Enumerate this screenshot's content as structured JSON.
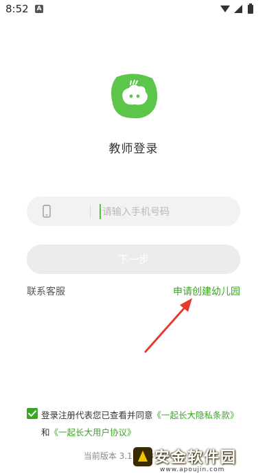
{
  "status_bar": {
    "time": "8:52",
    "notification_letter": "A"
  },
  "login": {
    "title": "教师登录",
    "phone_placeholder": "请输入手机号码",
    "next_label": "下一步",
    "contact_label": "联系客服",
    "apply_label": "申请创建幼儿园"
  },
  "agreement": {
    "checked": true,
    "prefix": "登录注册代表您已查看并同意",
    "privacy_link": "《一起长大隐私条款》",
    "and": "和",
    "user_link": "《一起长大用户协议》"
  },
  "footer": {
    "version": "当前版本 3.18.0(318000)"
  },
  "watermark": {
    "text": "安金软件园",
    "url": "www.apoujin.com"
  },
  "colors": {
    "brand_green": "#3aa624",
    "logo_green": "#5cc64a",
    "annotation_red": "#e53a2f"
  }
}
